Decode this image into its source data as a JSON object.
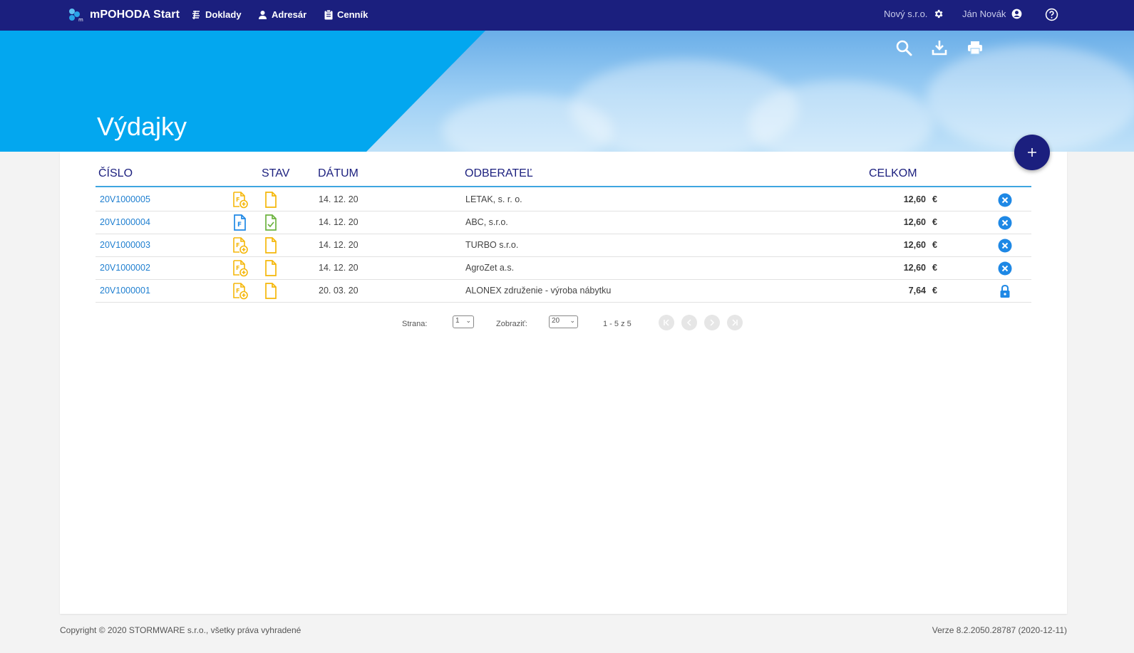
{
  "nav": {
    "brand": "mPOHODA Start",
    "links": [
      {
        "label": "Doklady"
      },
      {
        "label": "Adresár"
      },
      {
        "label": "Cenník"
      }
    ],
    "company": "Nový s.r.o.",
    "user": "Ján Novák"
  },
  "page": {
    "title": "Výdajky"
  },
  "table": {
    "headers": {
      "number": "ČÍSLO",
      "status": "STAV",
      "date": "DÁTUM",
      "customer": "ODBERATEĽ",
      "total": "CELKOM"
    },
    "rows": [
      {
        "number": "20V1000005",
        "date": "14. 12. 20",
        "customer": "LETAK, s. r. o.",
        "total": "12,60",
        "currency": "€",
        "doc_icon": "invoice-add-icon",
        "status_icon": "document-icon",
        "action_icon": "cancel-icon"
      },
      {
        "number": "20V1000004",
        "date": "14. 12. 20",
        "customer": "ABC, s.r.o.",
        "total": "12,60",
        "currency": "€",
        "doc_icon": "invoice-icon",
        "status_icon": "document-check-icon",
        "action_icon": "cancel-icon"
      },
      {
        "number": "20V1000003",
        "date": "14. 12. 20",
        "customer": "TURBO s.r.o.",
        "total": "12,60",
        "currency": "€",
        "doc_icon": "invoice-add-icon",
        "status_icon": "document-icon",
        "action_icon": "cancel-icon"
      },
      {
        "number": "20V1000002",
        "date": "14. 12. 20",
        "customer": "AgroZet a.s.",
        "total": "12,60",
        "currency": "€",
        "doc_icon": "invoice-add-icon",
        "status_icon": "document-icon",
        "action_icon": "cancel-icon"
      },
      {
        "number": "20V1000001",
        "date": "20. 03. 20",
        "customer": "ALONEX združenie - výroba nábytku",
        "total": "7,64",
        "currency": "€",
        "doc_icon": "invoice-add-icon",
        "status_icon": "document-icon",
        "action_icon": "lock-icon"
      }
    ]
  },
  "pager": {
    "page_label": "Strana:",
    "page_value": "1",
    "show_label": "Zobraziť:",
    "show_value": "20",
    "range": "1 - 5 z 5"
  },
  "footer": {
    "copyright": "Copyright © 2020 STORMWARE s.r.o., všetky práva vyhradené",
    "version": "Verze 8.2.2050.28787 (2020-12-11)"
  },
  "colors": {
    "nav_bg": "#1b1f7e",
    "hero_blue": "#03a7ef",
    "link": "#1f7fd0",
    "accent_line": "#3ea6e0",
    "icon_orange": "#f5b70a",
    "icon_green": "#6cb33f",
    "icon_blue": "#1e88e5"
  }
}
